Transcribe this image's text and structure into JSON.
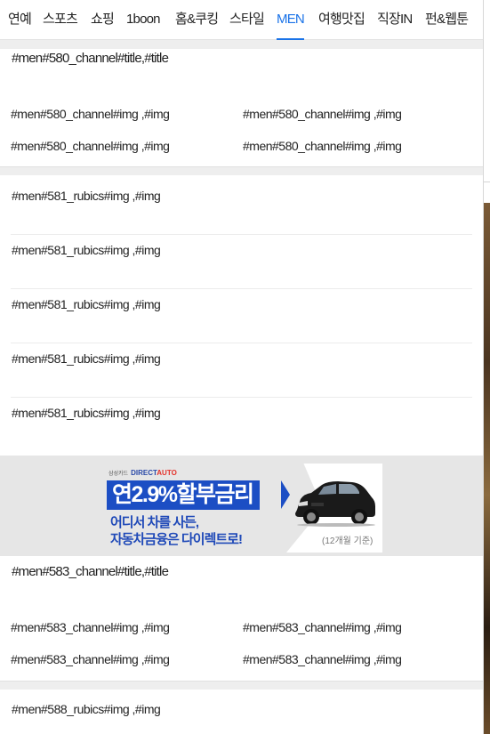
{
  "nav": {
    "items": [
      {
        "label": "연예"
      },
      {
        "label": "스포츠"
      },
      {
        "label": "쇼핑"
      },
      {
        "label": "1boon"
      },
      {
        "label": "홈&쿠킹"
      },
      {
        "label": "스타일"
      },
      {
        "label": "MEN"
      },
      {
        "label": "여행맛집"
      },
      {
        "label": "직장IN"
      },
      {
        "label": "펀&웹툰"
      }
    ],
    "active_index": 6,
    "active_color": "#1a73e8"
  },
  "channel_580": {
    "title": "#men#580_channel#title,#title",
    "imgs": [
      "#men#580_channel#img ,#img",
      "#men#580_channel#img ,#img",
      "#men#580_channel#img ,#img",
      "#men#580_channel#img ,#img"
    ]
  },
  "rubics_581": {
    "items": [
      "#men#581_rubics#img ,#img",
      "#men#581_rubics#img ,#img",
      "#men#581_rubics#img ,#img",
      "#men#581_rubics#img ,#img",
      "#men#581_rubics#img ,#img"
    ]
  },
  "banner": {
    "brand_small": "삼성카드",
    "brand_direct": "DIRECT",
    "brand_auto": "AUTO",
    "rate_text": "연2.9%할부금리",
    "line1": "어디서 차를 사든,",
    "line2": "자동차금융은 다이렉트로!",
    "note": "(12개월 기준)",
    "accent_color": "#1c4ec4"
  },
  "channel_583": {
    "title": "#men#583_channel#title,#title",
    "imgs": [
      "#men#583_channel#img ,#img",
      "#men#583_channel#img ,#img",
      "#men#583_channel#img ,#img",
      "#men#583_channel#img ,#img"
    ]
  },
  "rubics_588": {
    "items": [
      "#men#588_rubics#img ,#img"
    ]
  }
}
